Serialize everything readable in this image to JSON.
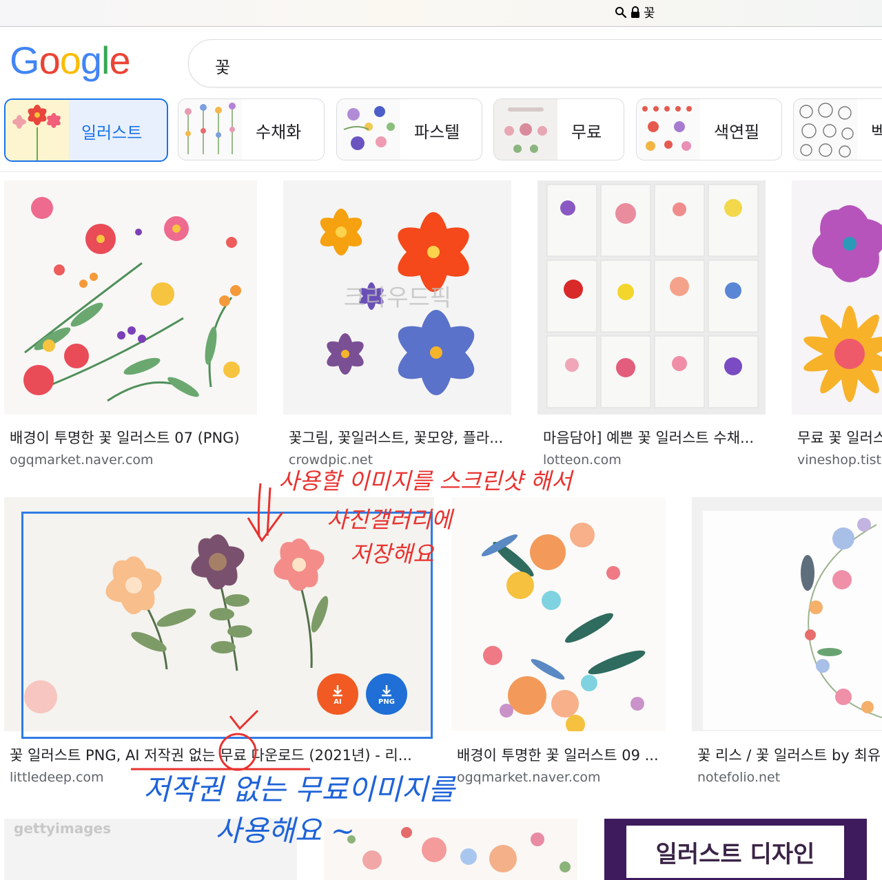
{
  "browser": {
    "url_text": "꽃"
  },
  "header": {
    "logo_letters": [
      {
        "ch": "G",
        "color": "#4285F4"
      },
      {
        "ch": "o",
        "color": "#EA4335"
      },
      {
        "ch": "o",
        "color": "#FBBC05"
      },
      {
        "ch": "g",
        "color": "#4285F4"
      },
      {
        "ch": "l",
        "color": "#34A853"
      },
      {
        "ch": "e",
        "color": "#EA4335"
      }
    ],
    "search_query": "꽃"
  },
  "chips": [
    {
      "label": "일러스트",
      "active": true
    },
    {
      "label": "수채화"
    },
    {
      "label": "파스텔"
    },
    {
      "label": "무료"
    },
    {
      "label": "색연필"
    },
    {
      "label": "벡"
    }
  ],
  "results": [
    {
      "title": "배경이 투명한 꽃 일러스트 07 (PNG)",
      "source": "ogqmarket.naver.com"
    },
    {
      "title": "꽃그림, 꽃일러스트, 꽃모양, 플라...",
      "source": "crowdpic.net",
      "watermark": "크라우드픽"
    },
    {
      "title": "마음담아] 예쁜 꽃 일러스트 수채...",
      "source": "lotteon.com"
    },
    {
      "title": "무료 꽃 일러스",
      "source": "vineshop.tist"
    },
    {
      "title": "꽃 일러스트 PNG, AI 저작권 없는 무료 다운로드 (2021년) - 리...",
      "source": "littledeep.com",
      "badges": [
        "AI",
        "PNG"
      ]
    },
    {
      "title": "배경이 투명한 꽃 일러스트 09 ...",
      "source": "ogqmarket.naver.com"
    },
    {
      "title": "꽃 리스 / 꽃 일러스트 by 최유",
      "source": "notefolio.net"
    },
    {
      "watermark": "gettyimages"
    },
    {},
    {
      "banner_text": "일러스트 디자인"
    }
  ],
  "annotations": {
    "red": [
      "사용할 이미지를 스크린샷 해서",
      "사진갤러리에",
      "저장해요"
    ],
    "blue": [
      "저작권 없는 무료이미지를",
      "사용해요 ~"
    ],
    "colors": {
      "red": "#e8322f",
      "blue": "#1e63d8"
    }
  }
}
